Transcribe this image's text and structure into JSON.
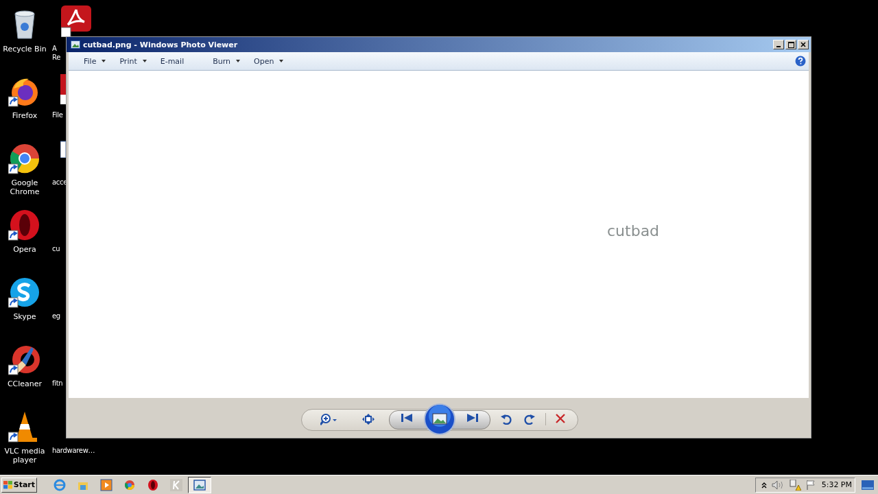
{
  "desktop_icons": [
    {
      "kind": "recycle",
      "label_lines": [
        "Recycle Bin"
      ]
    },
    {
      "kind": "firefox",
      "label_lines": [
        "Firefox"
      ]
    },
    {
      "kind": "chrome",
      "label_lines": [
        "Google",
        "Chrome"
      ]
    },
    {
      "kind": "opera",
      "label_lines": [
        "Opera"
      ]
    },
    {
      "kind": "skype",
      "label_lines": [
        "Skype"
      ]
    },
    {
      "kind": "ccleaner",
      "label_lines": [
        "CCleaner"
      ]
    },
    {
      "kind": "vlc",
      "label_lines": [
        "VLC media",
        "player"
      ]
    }
  ],
  "desktop_icons_2": [
    {
      "kind": "acrobat",
      "label_lines": [
        "A",
        "Re"
      ]
    },
    {
      "kind": "file",
      "label_lines": [
        "File"
      ]
    },
    {
      "kind": "doc",
      "label_lines": [
        "acce"
      ]
    },
    {
      "kind": "none",
      "label_lines": [
        "cu"
      ]
    },
    {
      "kind": "none",
      "label_lines": [
        "eg"
      ]
    },
    {
      "kind": "none",
      "label_lines": [
        "fitn"
      ]
    },
    {
      "kind": "none",
      "label_lines": [
        "hardwarew…"
      ]
    }
  ],
  "window": {
    "title": "cutbad.png - Windows Photo Viewer",
    "menu": [
      {
        "label": "File",
        "dropdown": true
      },
      {
        "label": "Print",
        "dropdown": true
      },
      {
        "label": "E-mail",
        "dropdown": false
      },
      {
        "label": "Burn",
        "dropdown": true
      },
      {
        "label": "Open",
        "dropdown": true
      }
    ],
    "image_text": "cutbad",
    "toolbar": [
      {
        "kind": "zoom"
      },
      {
        "kind": "fit"
      },
      {
        "kind": "prev"
      },
      {
        "kind": "slideshow"
      },
      {
        "kind": "next"
      },
      {
        "kind": "rotate-left"
      },
      {
        "kind": "rotate-right"
      },
      {
        "kind": "delete"
      }
    ]
  },
  "taskbar": {
    "start": "Start",
    "apps": [
      {
        "kind": "ie",
        "active": false
      },
      {
        "kind": "explorer",
        "active": false
      },
      {
        "kind": "media",
        "active": false
      },
      {
        "kind": "chrome",
        "active": false
      },
      {
        "kind": "opera",
        "active": false
      },
      {
        "kind": "k",
        "active": false
      },
      {
        "kind": "photo",
        "active": true
      }
    ],
    "tray": [
      {
        "kind": "chevron"
      },
      {
        "kind": "volume"
      },
      {
        "kind": "network"
      },
      {
        "kind": "flag"
      }
    ],
    "clock": "5:32 PM"
  }
}
